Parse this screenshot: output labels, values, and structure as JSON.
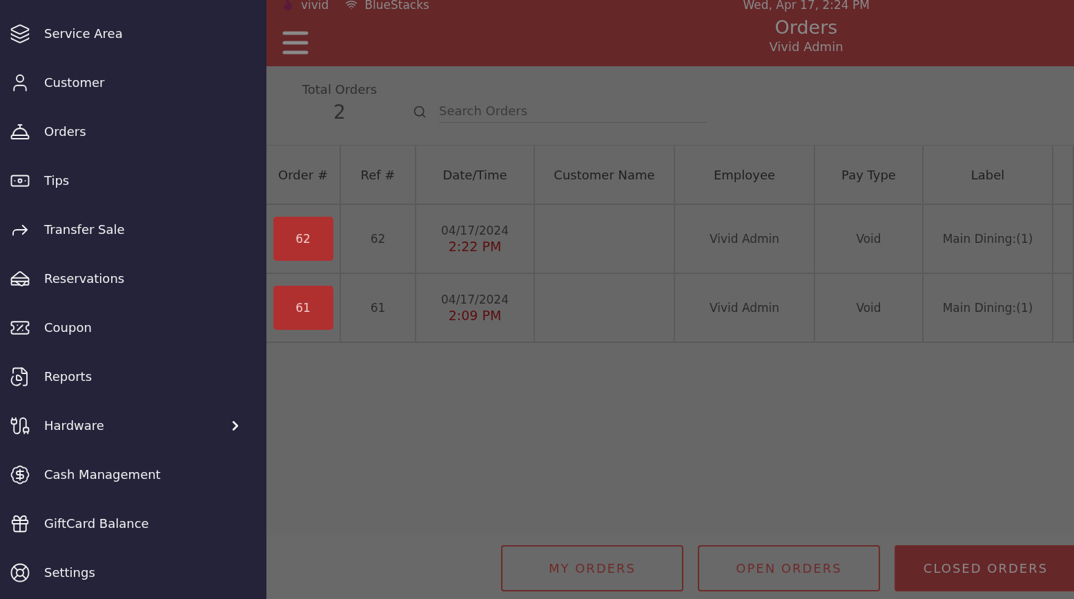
{
  "sidebar": {
    "items": [
      {
        "label": "Service Area",
        "kind": "link"
      },
      {
        "label": "Customer",
        "kind": "link"
      },
      {
        "label": "Orders",
        "kind": "link"
      },
      {
        "label": "Tips",
        "kind": "link"
      },
      {
        "label": "Transfer Sale",
        "kind": "link"
      },
      {
        "label": "Reservations",
        "kind": "link"
      },
      {
        "label": "Coupon",
        "kind": "link"
      },
      {
        "label": "Reports",
        "kind": "link"
      },
      {
        "label": "Hardware",
        "kind": "submenu"
      },
      {
        "label": "Cash Management",
        "kind": "link"
      },
      {
        "label": "GiftCard Balance",
        "kind": "link"
      },
      {
        "label": "Settings",
        "kind": "link"
      }
    ]
  },
  "status_bar": {
    "app": "vivid",
    "network": "BlueStacks",
    "datetime": "Wed, Apr 17, 2:24 PM"
  },
  "header": {
    "title": "Orders",
    "subtitle": "Vivid Admin"
  },
  "summary": {
    "label": "Total Orders",
    "count": "2"
  },
  "search": {
    "placeholder": "Search Orders"
  },
  "table": {
    "columns": [
      "Order #",
      "Ref #",
      "Date/Time",
      "Customer Name",
      "Employee",
      "Pay Type",
      "Label"
    ],
    "rows": [
      {
        "order": "62",
        "ref": "62",
        "date": "04/17/2024",
        "time": "2:22 PM",
        "employee": "Vivid Admin",
        "pay_type": "Void",
        "label": "Main Dining:(1)"
      },
      {
        "order": "61",
        "ref": "61",
        "date": "04/17/2024",
        "time": "2:09 PM",
        "employee": "Vivid Admin",
        "pay_type": "Void",
        "label": "Main Dining:(1)"
      }
    ]
  },
  "filters": [
    {
      "label": "MY ORDERS",
      "selected": false
    },
    {
      "label": "OPEN ORDERS",
      "selected": false
    },
    {
      "label": "CLOSED ORDERS",
      "selected": true
    }
  ]
}
